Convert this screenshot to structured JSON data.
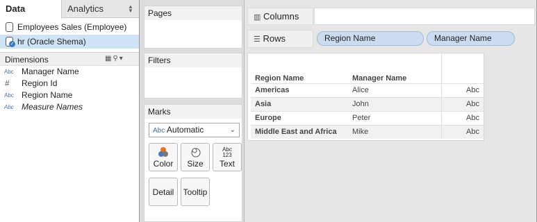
{
  "tabs": {
    "data": "Data",
    "analytics": "Analytics"
  },
  "datasources": [
    {
      "label": "Employees Sales (Employee)"
    },
    {
      "label": "hr (Oracle Shema)"
    }
  ],
  "dimensions": {
    "title": "Dimensions",
    "fields": [
      {
        "type": "Abc",
        "label": "Manager Name"
      },
      {
        "type": "#",
        "label": "Region Id"
      },
      {
        "type": "Abc",
        "label": "Region Name"
      },
      {
        "type": "Abc",
        "label": "Measure Names"
      }
    ]
  },
  "shelves": {
    "pages": "Pages",
    "filters": "Filters",
    "marks": "Marks",
    "columns": "Columns",
    "rows": "Rows",
    "row_pills": [
      "Region Name",
      "Manager Name"
    ]
  },
  "marks": {
    "type_prefix": "Abc",
    "type_value": "Automatic",
    "buttons": {
      "color": "Color",
      "size": "Size",
      "text": "Text",
      "detail": "Detail",
      "tooltip": "Tooltip"
    },
    "text_icon": [
      "Abc",
      "123"
    ]
  },
  "viz": {
    "headers": [
      "Region Name",
      "Manager Name",
      ""
    ],
    "rows": [
      {
        "region": "Americas",
        "manager": "Alice",
        "value": "Abc"
      },
      {
        "region": "Asia",
        "manager": "John",
        "value": "Abc"
      },
      {
        "region": "Europe",
        "manager": "Peter",
        "value": "Abc"
      },
      {
        "region": "Middle East and Africa",
        "manager": "Mike",
        "value": "Abc"
      }
    ]
  },
  "colors": {
    "selected_bg": "#cfe3f6",
    "pill_bg": "#cbdcf0",
    "canvas_bg": "#e6e6e6"
  }
}
